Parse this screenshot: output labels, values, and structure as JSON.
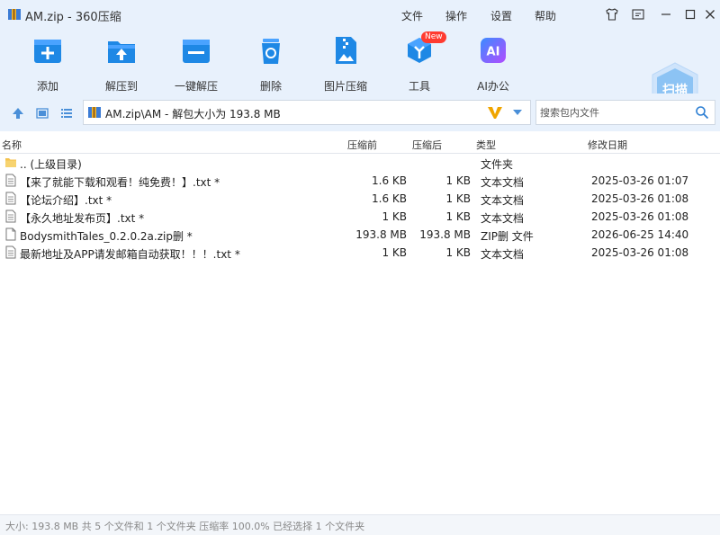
{
  "window": {
    "title": "AM.zip - 360压缩"
  },
  "menu": [
    "文件",
    "操作",
    "设置",
    "帮助"
  ],
  "toolbar": {
    "items": [
      "添加",
      "解压到",
      "一键解压",
      "删除",
      "图片压缩",
      "工具",
      "AI办公"
    ],
    "new_badge": "New",
    "scan": "扫描"
  },
  "address": {
    "path": "AM.zip\\AM - 解包大小为 193.8 MB"
  },
  "search": {
    "placeholder": "搜索包内文件"
  },
  "columns": [
    "名称",
    "压缩前",
    "压缩后",
    "类型",
    "修改日期"
  ],
  "files": [
    {
      "name": ".. (上级目录)",
      "before": "",
      "after": "",
      "type": "文件夹",
      "date": ""
    },
    {
      "name": "【来了就能下载和观看！纯免费！】.txt *",
      "before": "1.6 KB",
      "after": "1 KB",
      "type": "文本文档",
      "date": "2025-03-26 01:07"
    },
    {
      "name": "【论坛介绍】.txt *",
      "before": "1.6 KB",
      "after": "1 KB",
      "type": "文本文档",
      "date": "2025-03-26 01:08"
    },
    {
      "name": "【永久地址发布页】.txt *",
      "before": "1 KB",
      "after": "1 KB",
      "type": "文本文档",
      "date": "2025-03-26 01:08"
    },
    {
      "name": "BodysmithTales_0.2.0.2a.zip删 *",
      "before": "193.8 MB",
      "after": "193.8 MB",
      "type": "ZIP删 文件",
      "date": "2026-06-25 14:40"
    },
    {
      "name": "最新地址及APP请发邮箱自动获取！！！.txt *",
      "before": "1 KB",
      "after": "1 KB",
      "type": "文本文档",
      "date": "2025-03-26 01:08"
    }
  ],
  "status": "大小: 193.8 MB 共 5 个文件和 1 个文件夹 压缩率 100.0% 已经选择 1 个文件夹",
  "colors": {
    "accent": "#1e88e5",
    "chrome": "#e8f1fc",
    "badge": "#ff3b30"
  }
}
